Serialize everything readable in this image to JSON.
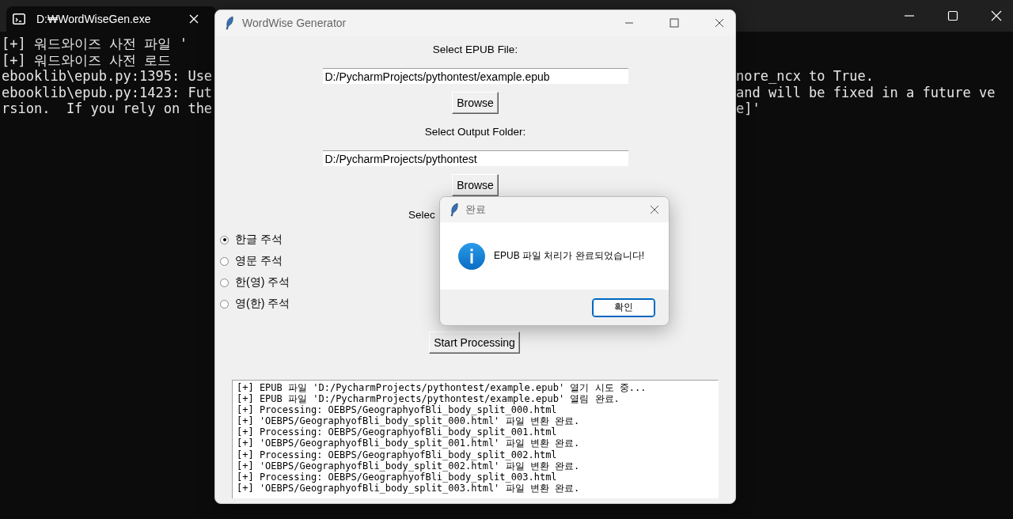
{
  "terminal": {
    "tab_title": "D:₩WordWiseGen.exe",
    "lines": [
      {
        "left": "[+] 워드와이즈 사전 파일 '"
      },
      {
        "left": "[+] 워드와이즈 사전 로드"
      },
      {
        "left": "ebooklib\\epub.py:1395: Use",
        "right": "nore_ncx to True."
      },
      {
        "left": "ebooklib\\epub.py:1423: Fut",
        "right": "and will be fixed in a future ve"
      },
      {
        "left": "rsion.  If you rely on the",
        "right": "e]'"
      }
    ]
  },
  "app_window": {
    "title": "WordWise Generator",
    "fields": [
      {
        "label": "Select EPUB File:",
        "value": "D:/PycharmProjects/pythontest/example.epub",
        "button": "Browse"
      },
      {
        "label": "Select Output Folder:",
        "value": "D:/PycharmProjects/pythontest",
        "button": "Browse"
      }
    ],
    "mode_label": "Selec",
    "options": [
      {
        "label": "한글 주석",
        "selected": true
      },
      {
        "label": "영문 주석",
        "selected": false
      },
      {
        "label": "한(영) 주석",
        "selected": false
      },
      {
        "label": "영(한) 주석",
        "selected": false
      }
    ],
    "start_button": "Start Processing",
    "log": [
      "[+] EPUB 파일 'D:/PycharmProjects/pythontest/example.epub' 열기 시도 중...",
      "[+] EPUB 파일 'D:/PycharmProjects/pythontest/example.epub' 열림 완료.",
      "[+] Processing: OEBPS/GeographyofBli_body_split_000.html",
      "[+] 'OEBPS/GeographyofBli_body_split_000.html' 파일 변환 완료.",
      "[+] Processing: OEBPS/GeographyofBli_body_split_001.html",
      "[+] 'OEBPS/GeographyofBli_body_split_001.html' 파일 변환 완료.",
      "[+] Processing: OEBPS/GeographyofBli_body_split_002.html",
      "[+] 'OEBPS/GeographyofBli_body_split_002.html' 파일 변환 완료.",
      "[+] Processing: OEBPS/GeographyofBli_body_split_003.html",
      "[+] 'OEBPS/GeographyofBli_body_split_003.html' 파일 변환 완료."
    ]
  },
  "dialog": {
    "title": "완료",
    "message": "EPUB 파일 처리가 완료되었습니다!",
    "button": "확인"
  }
}
